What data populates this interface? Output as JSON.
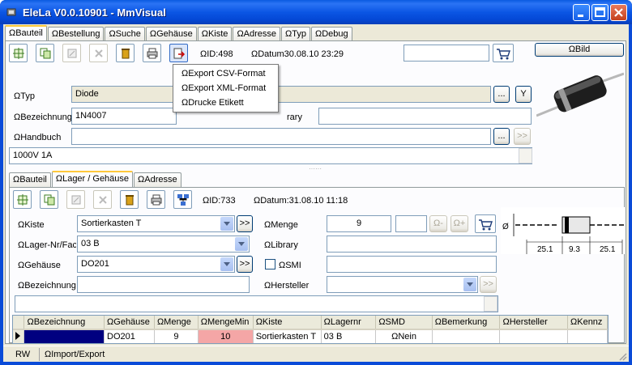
{
  "window": {
    "title": "EleLa V0.0.10901  - MmVisual"
  },
  "main_tabs": [
    "ΩBauteil",
    "ΩBestellung",
    "ΩSuche",
    "ΩGehäuse",
    "ΩKiste",
    "ΩAdresse",
    "ΩTyp",
    "ΩDebug"
  ],
  "bauteil": {
    "id": "ΩID:498",
    "datum": "ΩDatum30.08.10 23:29",
    "search_value": "",
    "bild_button": "ΩBild",
    "typ_label": "ΩTyp",
    "typ_value": "Diode",
    "typ_btn_dots": "...",
    "typ_btn_y": "Y",
    "bezeichnung_label": "ΩBezeichnung",
    "bezeichnung_value": "1N4007",
    "library_label": "rary",
    "library_value": "",
    "handbuch_label": "ΩHandbuch",
    "handbuch_value": "",
    "handbuch_dots": "...",
    "handbuch_go": ">>",
    "beschreibung_value": "1000V 1A"
  },
  "export_menu": {
    "items": [
      "ΩExport CSV-Format",
      "ΩExport XML-Format",
      "ΩDrucke Etikett"
    ]
  },
  "sub_tabs": [
    "ΩBauteil",
    "ΩLager / Gehäuse",
    "ΩAdresse"
  ],
  "lager": {
    "id": "ΩID:733",
    "datum": "ΩDatum:31.08.10 11:18",
    "kiste_label": "ΩKiste",
    "kiste_value": "Sortierkasten T",
    "kiste_go": ">>",
    "lager_label": "ΩLager-Nr/Fach",
    "lager_value": "03 B",
    "gehaeuse_label": "ΩGehäuse",
    "gehaeuse_value": "DO201",
    "gehaeuse_go": ">>",
    "bezeichnung_label": "ΩBezeichnung",
    "bezeichnung_value": "",
    "menge_label": "ΩMenge",
    "menge_value": "9",
    "menge_step_value": "",
    "minus_label": "Ω-",
    "plus_label": "Ω+",
    "library_label": "ΩLibrary",
    "library_value": "",
    "smd_label": "ΩSMI",
    "smd_value": "",
    "hersteller_label": "ΩHersteller",
    "hersteller_value": "",
    "hersteller_go": ">>",
    "notes_value": ""
  },
  "drawing": {
    "dims": [
      "25.1",
      "9.3",
      "25.1"
    ],
    "dia_label": "Ø"
  },
  "grid": {
    "columns": [
      "ΩBezeichnung",
      "ΩGehäuse",
      "ΩMenge",
      "ΩMengeMin",
      "ΩKiste",
      "ΩLagernr",
      "ΩSMD",
      "ΩBemerkung",
      "ΩHersteller",
      "ΩKennz"
    ],
    "rows": [
      {
        "bezeichnung": "",
        "gehaeuse": "DO201",
        "menge": "9",
        "mengemin": "10",
        "kiste": "Sortierkasten T",
        "lagernr": "03 B",
        "smd": "ΩNein",
        "bemerkung": "",
        "hersteller": "",
        "kennz": ""
      }
    ]
  },
  "status": {
    "mode": "RW",
    "message": "ΩImport/Export"
  },
  "colors": {
    "titlebar": "#0b56e4",
    "selection": "#000080",
    "warning_cell": "#f4a6a6",
    "tab_highlight": "#ffc83c"
  }
}
